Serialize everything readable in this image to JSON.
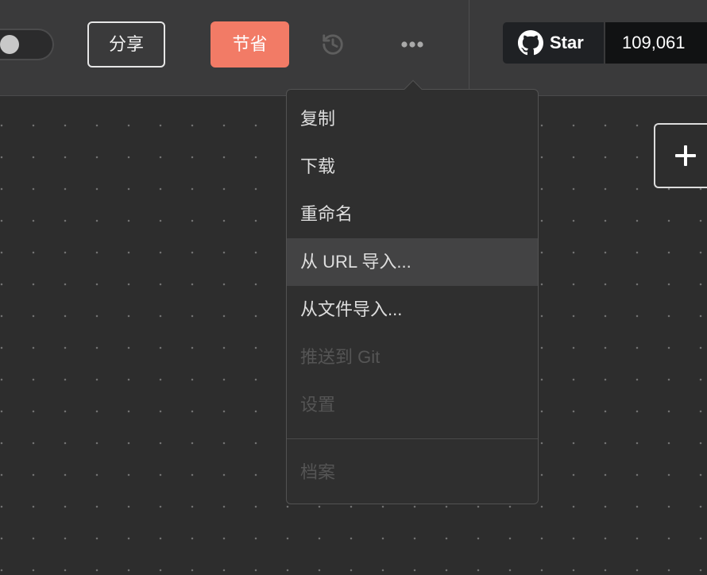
{
  "toolbar": {
    "toggle": {
      "on": false
    },
    "share_label": "分享",
    "save_label": "节省",
    "history_icon": "history-icon",
    "more_icon": "more-horizontal-icon"
  },
  "github": {
    "icon": "github-icon",
    "star_label": "Star",
    "star_count": "109,061"
  },
  "canvas": {
    "add_icon": "plus-icon"
  },
  "menu": {
    "items": [
      {
        "label": "复制",
        "enabled": true
      },
      {
        "label": "下载",
        "enabled": true
      },
      {
        "label": "重命名",
        "enabled": true
      },
      {
        "label": "从 URL 导入...",
        "enabled": true,
        "highlighted": true
      },
      {
        "label": "从文件导入...",
        "enabled": true
      },
      {
        "label": "推送到 Git",
        "enabled": false
      },
      {
        "label": "设置",
        "enabled": false
      }
    ],
    "footer_items": [
      {
        "label": "档案",
        "enabled": false
      }
    ]
  },
  "colors": {
    "toolbar_bg": "#3a3a3b",
    "canvas_bg": "#2d2d2d",
    "menu_bg": "#2f2f2f",
    "menu_highlight": "#434344",
    "accent": "#f27b66",
    "text": "#dedede",
    "text_disabled": "#555555"
  }
}
